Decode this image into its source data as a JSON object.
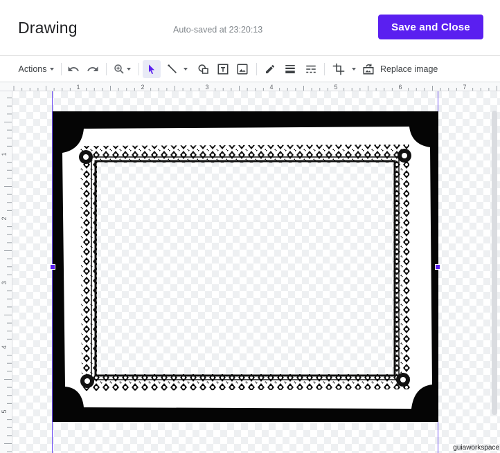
{
  "header": {
    "title": "Drawing",
    "autosave_text": "Auto-saved at 23:20:13",
    "save_button_label": "Save and Close"
  },
  "toolbar": {
    "actions_label": "Actions",
    "replace_image_label": "Replace image",
    "tools": [
      {
        "name": "undo-icon"
      },
      {
        "name": "redo-icon"
      },
      {
        "name": "zoom-icon"
      },
      {
        "name": "select-icon",
        "active": true
      },
      {
        "name": "line-icon"
      },
      {
        "name": "shape-icon"
      },
      {
        "name": "text-box-icon"
      },
      {
        "name": "image-icon"
      },
      {
        "name": "pencil-icon"
      },
      {
        "name": "line-weight-icon"
      },
      {
        "name": "line-dash-icon"
      },
      {
        "name": "crop-icon"
      },
      {
        "name": "replace-image-icon"
      }
    ]
  },
  "rulers": {
    "horizontal_labels": [
      "1",
      "2",
      "3",
      "4",
      "5",
      "6",
      "7"
    ],
    "vertical_labels": [
      "1",
      "2",
      "3",
      "4",
      "5"
    ]
  },
  "canvas": {
    "image_description_name": "ornate-frame-image",
    "colors": {
      "accent": "#5a1ff0",
      "guide": "#6d4df2",
      "frame_black": "#050505"
    }
  },
  "watermark": "guiaworkspace"
}
